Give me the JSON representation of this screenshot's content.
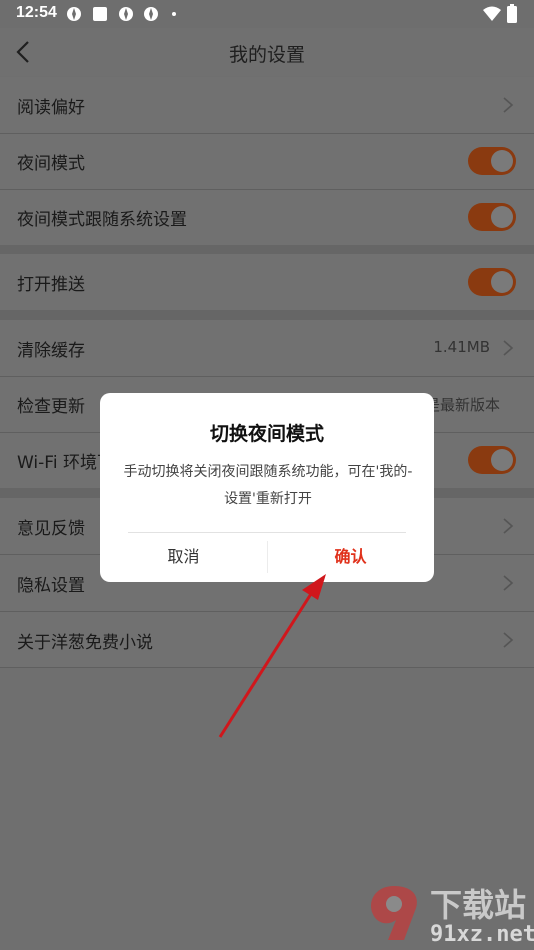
{
  "status_bar": {
    "time": "12:54"
  },
  "header": {
    "title": "我的设置"
  },
  "settings": {
    "reading_pref": "阅读偏好",
    "night_mode": "夜间模式",
    "night_follow": "夜间模式跟随系统设置",
    "push": "打开推送",
    "clear_cache": "清除缓存",
    "cache_size": "1.41MB",
    "check_update": "检查更新",
    "update_status_partial": "是最新版本",
    "wifi_partial": "Wi-Fi 环境下",
    "feedback": "意见反馈",
    "privacy": "隐私设置",
    "about": "关于洋葱免费小说"
  },
  "dialog": {
    "title": "切换夜间模式",
    "message": "手动切换将关闭夜间跟随系统功能，可在'我的-设置'重新打开",
    "cancel": "取消",
    "confirm": "确认"
  },
  "watermark": {
    "top": "下载站",
    "bottom": "91xz.net"
  },
  "colors": {
    "accent": "#e0311b",
    "toggle_on": "#8a3a10",
    "overlay": "#6f6f6f"
  }
}
